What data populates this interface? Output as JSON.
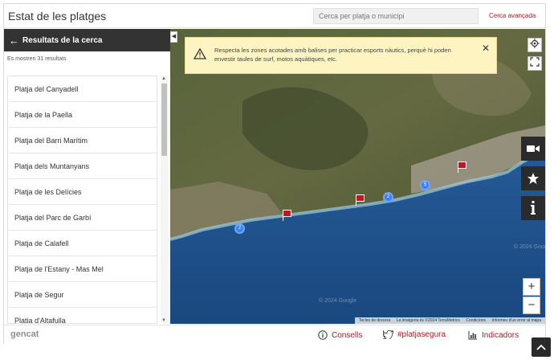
{
  "header": {
    "title": "Estat de les platges",
    "search_placeholder": "Cerca per platja o municipi",
    "advanced_search": "Cerca avançada"
  },
  "sidebar": {
    "back_icon": "arrow-left-icon",
    "heading": "Resultats de la cerca",
    "count_text": "Es mostren 31 resultats",
    "items": [
      {
        "label": "Platja del Canyadell"
      },
      {
        "label": "Platja de la Paella"
      },
      {
        "label": "Platja del Barri Marítim"
      },
      {
        "label": "Platja dels Muntanyans"
      },
      {
        "label": "Platja de les Delícies"
      },
      {
        "label": "Platja del Parc de Garbí"
      },
      {
        "label": "Platja de Calafell"
      },
      {
        "label": "Platja de l'Estany - Mas Mel"
      },
      {
        "label": "Platja de Segur"
      },
      {
        "label": "Platja d'Altafulla"
      }
    ]
  },
  "map": {
    "alert": {
      "icon": "warning-icon",
      "text": "Respecta les zones acotades amb balises per practicar esports nàutics, perquè hi poden envestir taules de surf, motos aquàtiques, etc."
    },
    "clusters": [
      "2",
      "2",
      "5"
    ],
    "watermark": "© 2024 Google",
    "attribution": {
      "shortcuts": "Tecles de drecera",
      "imagery": "La imatgeria és ©2024 TerraMetrics",
      "terms": "Condicions",
      "report": "Informeu d'un error al mapa"
    },
    "controls": {
      "zoom_in": "+",
      "zoom_out": "−"
    },
    "colors": {
      "sea_deep": "#1c4c86",
      "sea_shallow": "#2f6db0",
      "land": "#5d6a3f",
      "urban": "#b8aea0",
      "flag_red": "#c4161c",
      "cluster_blue": "#3b82f6"
    }
  },
  "footer": {
    "logo": "gencat",
    "links": [
      {
        "label": "Consells",
        "icon": "info-icon"
      },
      {
        "label": "#platjasegura",
        "icon": "twitter-icon"
      },
      {
        "label": "Indicadors",
        "icon": "chart-icon"
      }
    ]
  },
  "colors": {
    "accent": "#b3181d",
    "dark": "#333333"
  }
}
